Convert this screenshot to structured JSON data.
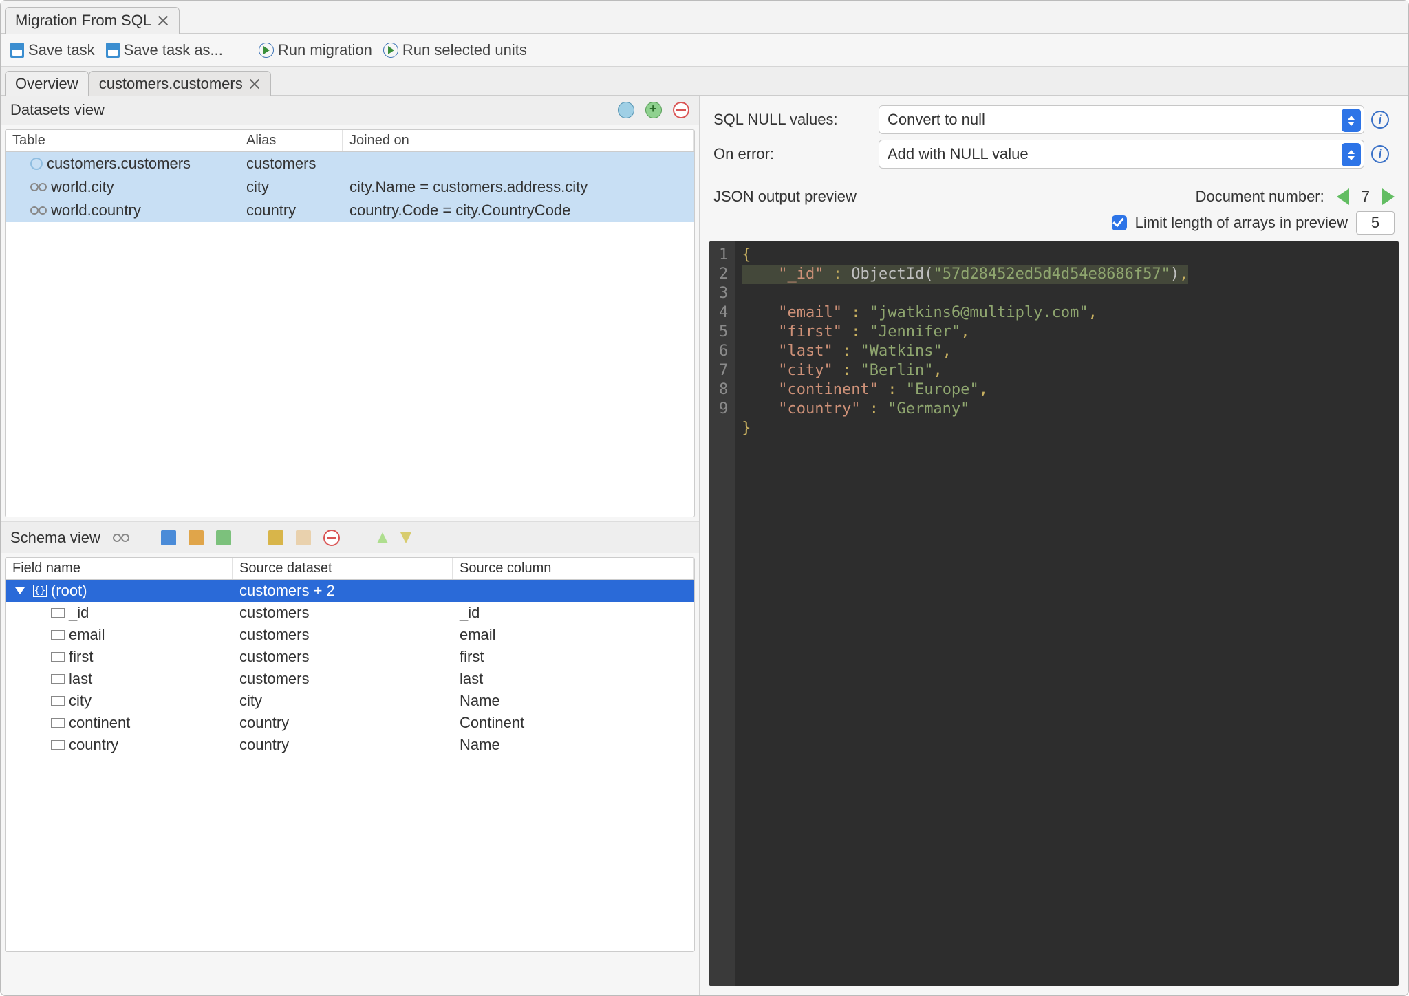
{
  "window": {
    "tab_title": "Migration From SQL"
  },
  "toolbar": {
    "save_task": "Save task",
    "save_task_as": "Save task as...",
    "run_migration": "Run migration",
    "run_selected": "Run selected units"
  },
  "subtabs": {
    "overview": "Overview",
    "active": "customers.customers"
  },
  "datasets": {
    "title": "Datasets view",
    "columns": {
      "table": "Table",
      "alias": "Alias",
      "joined": "Joined on"
    },
    "rows": [
      {
        "table": "customers.customers",
        "alias": "customers",
        "joined": "",
        "type": "root"
      },
      {
        "table": "world.city",
        "alias": "city",
        "joined": "city.Name = customers.address.city",
        "type": "join"
      },
      {
        "table": "world.country",
        "alias": "country",
        "joined": "country.Code = city.CountryCode",
        "type": "join"
      }
    ]
  },
  "schema": {
    "title": "Schema view",
    "columns": {
      "field": "Field name",
      "src_ds": "Source dataset",
      "src_col": "Source column"
    },
    "rows": [
      {
        "field": "(root)",
        "src": "customers + 2",
        "col": "",
        "root": true
      },
      {
        "field": "_id",
        "src": "customers",
        "col": "_id"
      },
      {
        "field": "email",
        "src": "customers",
        "col": "email"
      },
      {
        "field": "first",
        "src": "customers",
        "col": "first"
      },
      {
        "field": "last",
        "src": "customers",
        "col": "last"
      },
      {
        "field": "city",
        "src": "city",
        "col": "Name"
      },
      {
        "field": "continent",
        "src": "country",
        "col": "Continent"
      },
      {
        "field": "country",
        "src": "country",
        "col": "Name"
      }
    ]
  },
  "right": {
    "sql_null_label": "SQL NULL values:",
    "sql_null_value": "Convert to null",
    "on_error_label": "On error:",
    "on_error_value": "Add with NULL value",
    "json_preview_label": "JSON output preview",
    "doc_number_label": "Document number:",
    "doc_number": "7",
    "limit_label": "Limit length of arrays in preview",
    "limit_value": "5"
  },
  "json_preview": {
    "oid_fn": "ObjectId",
    "oid_val": "57d28452ed5d4d54e8686f57",
    "doc": {
      "_id_key": "_id",
      "email_key": "email",
      "email_val": "jwatkins6@multiply.com",
      "first_key": "first",
      "first_val": "Jennifer",
      "last_key": "last",
      "last_val": "Watkins",
      "city_key": "city",
      "city_val": "Berlin",
      "continent_key": "continent",
      "continent_val": "Europe",
      "country_key": "country",
      "country_val": "Germany"
    }
  }
}
